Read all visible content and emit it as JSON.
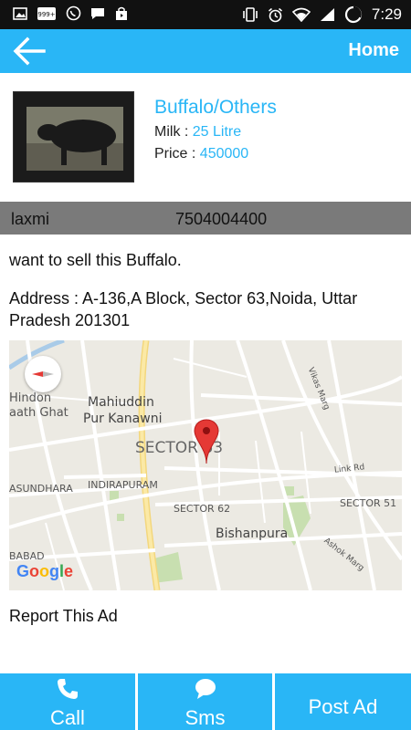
{
  "status_bar": {
    "time": "7:29",
    "notification_badge": "999+",
    "icons_left": [
      "gallery-icon",
      "notification-counter-icon",
      "whatsapp-icon",
      "chat-icon",
      "store-icon"
    ],
    "icons_right": [
      "vibrate-icon",
      "alarm-icon",
      "wifi-icon",
      "signal-icon",
      "battery-icon"
    ]
  },
  "app_bar": {
    "back_icon": "arrow-left-icon",
    "home_label": "Home",
    "color": "#29b6f6"
  },
  "listing": {
    "title": "Buffalo/Others",
    "milk_label": "Milk : ",
    "milk_value": "25 Litre",
    "price_label": "Price : ",
    "price_value": "450000"
  },
  "seller": {
    "name": "laxmi",
    "phone": "7504004400"
  },
  "description": "want to sell this Buffalo.",
  "address": "Address : A-136,A Block, Sector 63,Noida, Uttar Pradesh 201301",
  "map": {
    "labels": {
      "hindon": "Hindon",
      "ghat": "aath Ghat",
      "mahiuddin": "Mahiuddin",
      "kanawni": "Pur Kanawni",
      "sector63": "SECTOR 63",
      "indirapuram": "INDIRAPURAM",
      "vasundhara": "ASUNDHARA",
      "sector62": "SECTOR 62",
      "sector51": "SECTOR 51",
      "bishanpura": "Bishanpura",
      "babad": "BABAD",
      "link_rd": "Link Rd",
      "vikas_marg": "Vikas Marg",
      "ashok_marg": "Ashok Marg",
      "google": "Google"
    }
  },
  "report_label": "Report This Ad",
  "actions": {
    "call": "Call",
    "sms": "Sms",
    "post_ad": "Post Ad"
  }
}
